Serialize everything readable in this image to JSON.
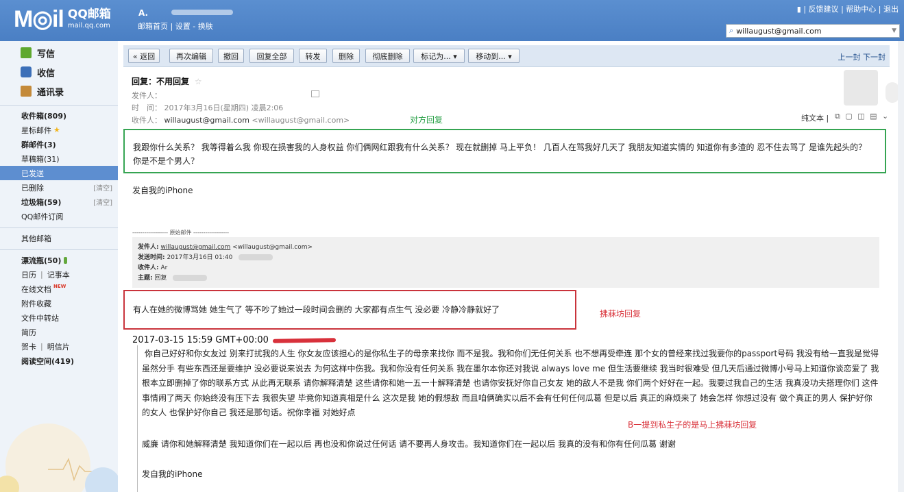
{
  "header": {
    "logo_main": "M◎il",
    "logo_brand": "QQ邮箱",
    "logo_url": "mail.qq.com",
    "user_name": "A.",
    "links": {
      "home": "邮箱首页",
      "settings": "设置",
      "skin": "换肤",
      "sep1": "|",
      "sep2": "-"
    },
    "top_right": {
      "feedback": "反馈建议",
      "help": "帮助中心",
      "logout": "退出",
      "sep": "|"
    },
    "account": "willaugust@gmail.com"
  },
  "sidebar": {
    "write": "写信",
    "inbox": "收信",
    "contacts": "通讯录",
    "folders": [
      {
        "label": "收件箱(809)",
        "bold": true
      },
      {
        "label": "星标邮件",
        "star": true
      },
      {
        "label": "群邮件(3)",
        "bold": true
      },
      {
        "label": "草稿箱(31)"
      },
      {
        "label": "已发送",
        "active": true
      },
      {
        "label": "已删除",
        "clear": "[清空]"
      },
      {
        "label": "垃圾箱(59)",
        "bold": true,
        "clear": "[清空]"
      },
      {
        "label": "QQ邮件订阅"
      }
    ],
    "other": "其他邮箱",
    "apps": {
      "bottle": "漂流瓶(50)",
      "calendar": "日历",
      "notes": "记事本",
      "docs": "在线文档",
      "new_tag": "NEW",
      "attachments": "附件收藏",
      "transfer": "文件中转站",
      "resume": "简历",
      "card": "贺卡",
      "postcard": "明信片",
      "reading": "阅读空间(419)",
      "pipe": "|"
    }
  },
  "toolbar": {
    "back": "« 返回",
    "edit_again": "再次编辑",
    "recall": "撤回",
    "reply_all": "回复全部",
    "forward": "转发",
    "delete": "删除",
    "delete_forever": "彻底删除",
    "mark_as": "标记为... ▾",
    "move_to": "移动到... ▾",
    "nav": "上一封  下一封"
  },
  "mail": {
    "subject": "回复：不用回复",
    "subject_star": "☆",
    "from_label": "发件人：",
    "time_label": "时　间：",
    "time_value": "2017年3月16日(星期四) 凌晨2:06",
    "to_label": "收件人：",
    "to_name": "willaugust@gmail.com",
    "to_addr": "<willaugust@gmail.com>",
    "plain_view": "纯文本 |",
    "view_icons": "⧉ ▢ ◫ ▤ ⌄",
    "annotation_top": "对方回复",
    "reply_body": "我跟你什么关系？ 我等得着么我 你现在损害我的人身权益 你们俩网红跟我有什么关系？ 现在就删掉 马上平负！ 几百人在骂我好几天了 我朋友知道实情的 知道你有多渣的 忍不住去骂了 是谁先起头的？ 你是不是个男人？",
    "sig1": "发自我的iPhone",
    "orig_sep": "------------------ 原始邮件 ------------------",
    "quote": {
      "from_label": "发件人:",
      "from_value": "willaugust@gmail.com",
      "from_addr": "<willaugust@gmail.com>",
      "sent_label": "发送时间:",
      "sent_value": "2017年3月16日 01:40",
      "to_label": "收件人:",
      "to_value": "Ar",
      "subject_label": "主题:",
      "subject_value": "回复"
    },
    "red_box_text": "有人在她的微博骂她 她生气了 等不吵了她过一段时间会删的 大家都有点生气 没必要 冷静冷静就好了",
    "annotation_red": "拂菻坊回复",
    "date_line": "2017-03-15 15:59 GMT+00:00",
    "long_reply": "你自己好好和你女友过 别来打扰我的人生 你女友应该担心的是你私生子的母亲来找你 而不是我。我和你们无任何关系 也不想再受牵连 那个女的曾经来找过我要你的passport号码 我没有给一直我是觉得虽然分手 有些东西还是要维护 没必要说来说去 为何这样中伤我。我和你没有任何关系 我在墨尔本你还对我说 always love me 但生活要继续 我当时很难受 但几天后通过微博小号马上知道你谈恋爱了 我根本立即删掉了你的联系方式  从此再无联系 请你解释清楚 这些请你和她一五一十解释清楚 也请你安抚好你自己女友 她的敌人不是我  你们两个好好在一起。我要过我自己的生活 我真没功夫搭理你们  这件事情闹了两天 你始终没有压下去 我很失望 毕竟你知道真相是什么 这次是我 她的假想敌 而且咱俩确实以后不会有任何任何瓜葛  但是以后 真正的麻烦来了 她会怎样 你想过没有 做个真正的男人 保护好你的女人 也保护好你自己 我还是那句话。祝你幸福 对她好点",
    "annotation_b": "B一提到私生子的是马上拂菻坊回复",
    "reply_text2": "威廉 请你和她解释清楚 我知道你们在一起以后 再也没和你说过任何话  请不要再人身攻击。我知道你们在一起以后 我真的没有和你有任何瓜葛 谢谢",
    "sig2": "发自我的iPhone"
  },
  "colors": {
    "header_blue": "#4a7fc4",
    "active_folder": "#5d8ed0",
    "annotation_green": "#27a046",
    "annotation_red": "#d9333b"
  }
}
